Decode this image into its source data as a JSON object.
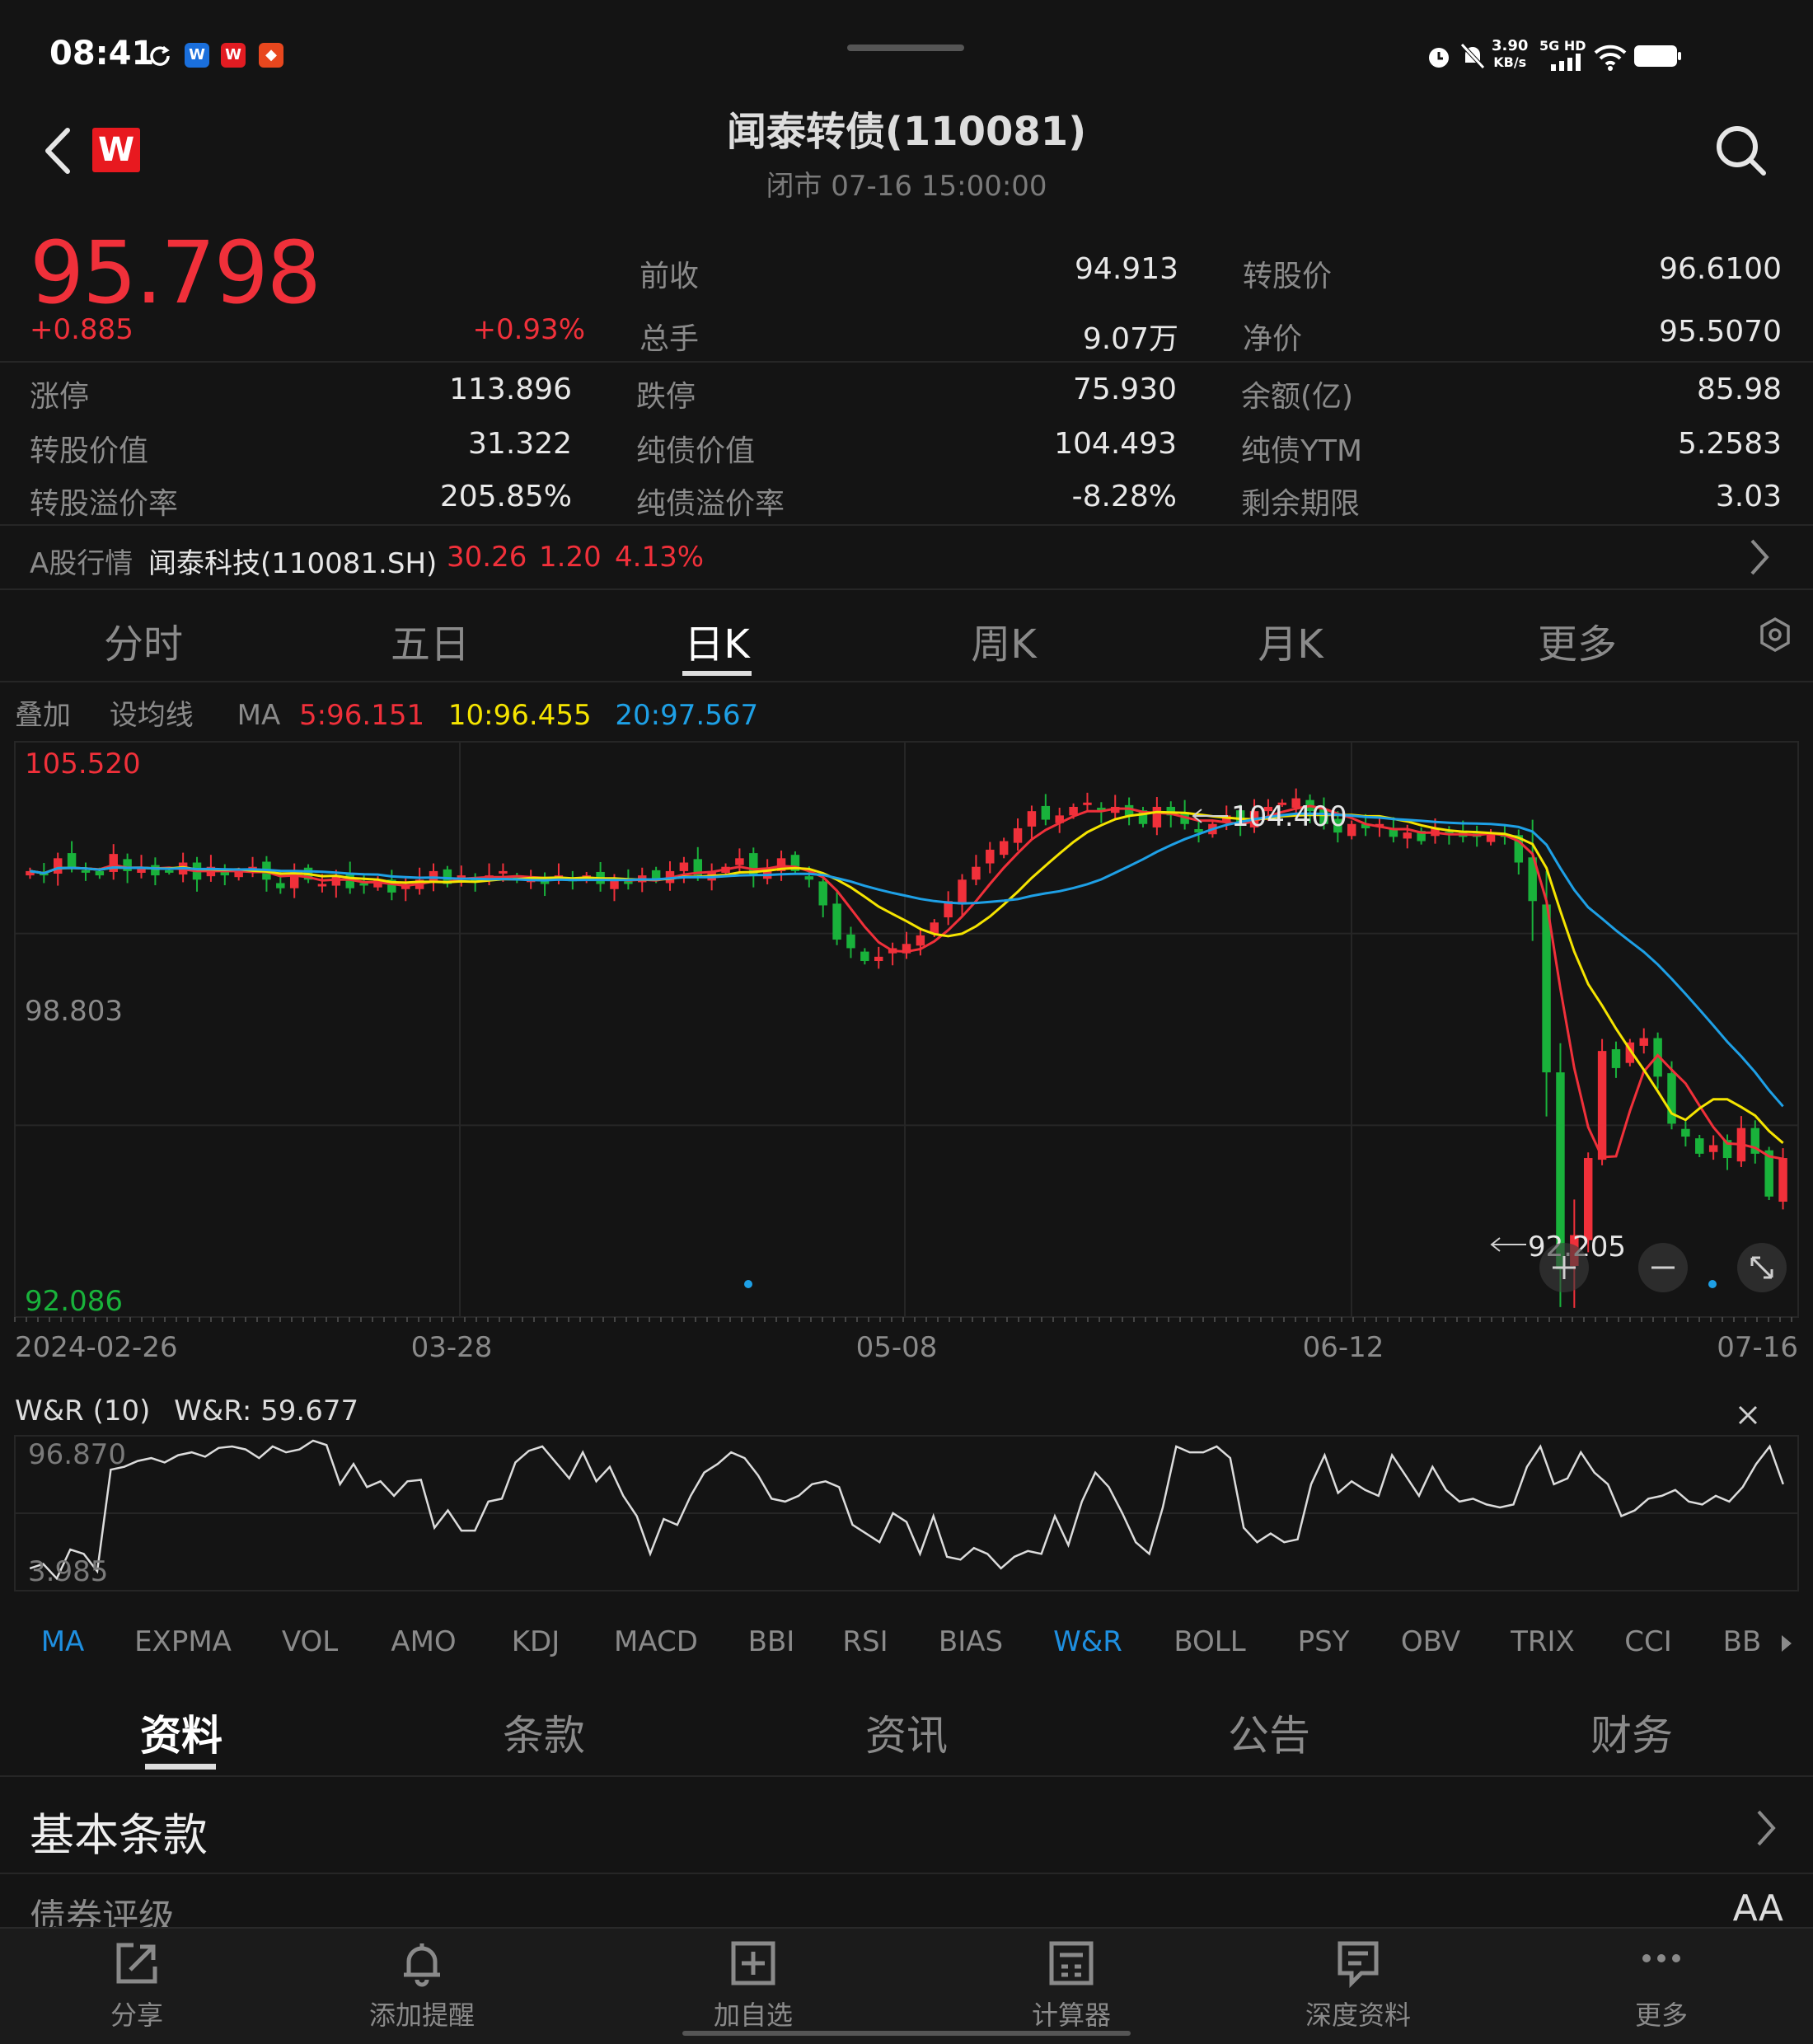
{
  "status_bar": {
    "time": "08:41",
    "net_speed": "3.90",
    "net_unit": "KB/s",
    "signal": "5G HD",
    "icons": [
      "sync-icon",
      "app-w-blue-icon",
      "app-w-red-icon",
      "app-red-icon",
      "alarm-icon",
      "mute-icon",
      "signal-icon",
      "wifi-icon",
      "battery-icon"
    ]
  },
  "header": {
    "title": "闻泰转债(110081)",
    "subtitle": "闭市 07-16 15:00:00",
    "logo_letter": "W"
  },
  "quote": {
    "price": "95.798",
    "change": "+0.885",
    "change_pct": "+0.93%",
    "stats": [
      {
        "label": "前收",
        "value": "94.913"
      },
      {
        "label": "转股价",
        "value": "96.6100"
      },
      {
        "label": "总手",
        "value": "9.07万"
      },
      {
        "label": "净价",
        "value": "95.5070"
      },
      {
        "label": "涨停",
        "value": "113.896"
      },
      {
        "label": "跌停",
        "value": "75.930"
      },
      {
        "label": "余额(亿)",
        "value": "85.98"
      },
      {
        "label": "转股价值",
        "value": "31.322"
      },
      {
        "label": "纯债价值",
        "value": "104.493"
      },
      {
        "label": "纯债YTM",
        "value": "5.2583"
      },
      {
        "label": "转股溢价率",
        "value": "205.85%"
      },
      {
        "label": "纯债溢价率",
        "value": "-8.28%"
      },
      {
        "label": "剩余期限",
        "value": "3.03"
      }
    ]
  },
  "stock_bar": {
    "label": "A股行情",
    "name": "闻泰科技(110081.SH)",
    "price": "30.26",
    "change": "1.20",
    "change_pct": "4.13%"
  },
  "period_tabs": [
    "分时",
    "五日",
    "日K",
    "周K",
    "月K",
    "更多"
  ],
  "active_period": "日K",
  "ma_legend": {
    "overlay": "叠加",
    "set_ma": "设均线",
    "ma_label": "MA",
    "ma5": "5:96.151",
    "ma10": "10:96.455",
    "ma20": "20:97.567"
  },
  "colors": {
    "up": "#f0303a",
    "down": "#19b23b",
    "ma5": "#f0303a",
    "ma10": "#f5e400",
    "ma20": "#1ea0e6",
    "accent": "#1e8fe0"
  },
  "chart_data": [
    {
      "type": "candlestick",
      "title": "日K",
      "y_axis_labels": [
        "105.520",
        "98.803",
        "92.086"
      ],
      "ylim": [
        92.086,
        105.52
      ],
      "x_tick_labels": [
        "2024-02-26",
        "03-28",
        "05-08",
        "06-12",
        "07-16"
      ],
      "max_annotation": "104.400",
      "min_annotation": "92.205",
      "close": [
        102.5,
        102.4,
        102.8,
        102.6,
        102.5,
        102.4,
        102.9,
        102.5,
        102.6,
        102.4,
        102.5,
        102.7,
        102.3,
        102.6,
        102.4,
        102.5,
        102.6,
        102.3,
        102.1,
        102.5,
        102.3,
        102.2,
        102.4,
        102.1,
        102.2,
        102.3,
        102.0,
        102.2,
        102.3,
        102.5,
        102.2,
        102.4,
        102.3,
        102.4,
        102.5,
        102.3,
        102.3,
        102.2,
        102.4,
        102.3,
        102.4,
        102.2,
        102.3,
        102.2,
        102.4,
        102.3,
        102.5,
        102.7,
        102.4,
        102.5,
        102.6,
        102.8,
        102.4,
        102.5,
        102.8,
        102.5,
        102.3,
        101.7,
        100.9,
        100.7,
        100.4,
        100.5,
        100.7,
        100.8,
        101.0,
        101.3,
        101.8,
        102.3,
        102.6,
        103.0,
        103.2,
        103.5,
        103.9,
        103.7,
        103.8,
        104.0,
        104.1,
        103.9,
        104.0,
        103.8,
        103.6,
        104.0,
        103.8,
        103.6,
        103.4,
        103.6,
        103.8,
        103.6,
        103.9,
        104.0,
        104.1,
        104.2,
        103.9,
        103.6,
        103.4,
        103.6,
        103.5,
        103.6,
        103.3,
        103.4,
        103.2,
        103.5,
        103.4,
        103.3,
        103.3,
        103.4,
        103.3,
        102.7,
        101.8,
        97.8,
        93.2,
        94.0,
        95.8,
        98.3,
        97.9,
        98.5,
        98.6,
        97.7,
        96.6,
        96.3,
        95.9,
        96.1,
        95.8,
        96.5,
        95.9,
        94.9,
        95.8
      ],
      "ma5_last": 96.151,
      "ma10_last": 96.455,
      "ma20_last": 97.567
    },
    {
      "type": "line",
      "title": "W&R (10)",
      "current_label": "W&R: 59.677",
      "y_axis_labels": [
        "96.870",
        "3.985"
      ],
      "ylim": [
        3.985,
        96.87
      ],
      "values": [
        12,
        15,
        5,
        25,
        22,
        10,
        80,
        82,
        86,
        88,
        85,
        90,
        92,
        89,
        95,
        96,
        94,
        88,
        96,
        92,
        94,
        100,
        97,
        70,
        84,
        68,
        72,
        62,
        72,
        73,
        40,
        52,
        38,
        38,
        58,
        60,
        85,
        93,
        96,
        85,
        74,
        92,
        72,
        82,
        62,
        48,
        22,
        46,
        42,
        62,
        78,
        84,
        92,
        88,
        76,
        60,
        58,
        62,
        70,
        72,
        68,
        42,
        36,
        30,
        50,
        44,
        22,
        48,
        20,
        18,
        26,
        22,
        12,
        20,
        24,
        22,
        48,
        28,
        58,
        78,
        68,
        50,
        30,
        22,
        54,
        96,
        92,
        92,
        96,
        88,
        40,
        30,
        36,
        30,
        32,
        70,
        90,
        64,
        72,
        66,
        62,
        90,
        76,
        62,
        82,
        66,
        58,
        60,
        56,
        54,
        56,
        82,
        96,
        70,
        74,
        92,
        78,
        70,
        48,
        52,
        60,
        62,
        66,
        58,
        56,
        62,
        58,
        68,
        84,
        96,
        70
      ]
    }
  ],
  "wr_title": "W&R (10)",
  "wr_value": "W&R: 59.677",
  "indicator_tabs": [
    "MA",
    "EXPMA",
    "VOL",
    "AMO",
    "KDJ",
    "MACD",
    "BBI",
    "RSI",
    "BIAS",
    "W&R",
    "BOLL",
    "PSY",
    "OBV",
    "TRIX",
    "CCI",
    "BB"
  ],
  "active_indicators": [
    "MA",
    "W&R"
  ],
  "info_tabs": [
    "资料",
    "条款",
    "资讯",
    "公告",
    "财务"
  ],
  "active_info_tab": "资料",
  "sections": {
    "basic_terms": "基本条款",
    "bond_rating_label": "债券评级",
    "bond_rating_value": "AA"
  },
  "bottom_nav": [
    {
      "label": "分享",
      "icon": "share-icon"
    },
    {
      "label": "添加提醒",
      "icon": "bell-icon"
    },
    {
      "label": "加自选",
      "icon": "add-watchlist-icon"
    },
    {
      "label": "计算器",
      "icon": "calculator-icon"
    },
    {
      "label": "深度资料",
      "icon": "document-icon"
    },
    {
      "label": "更多",
      "icon": "more-icon"
    }
  ]
}
